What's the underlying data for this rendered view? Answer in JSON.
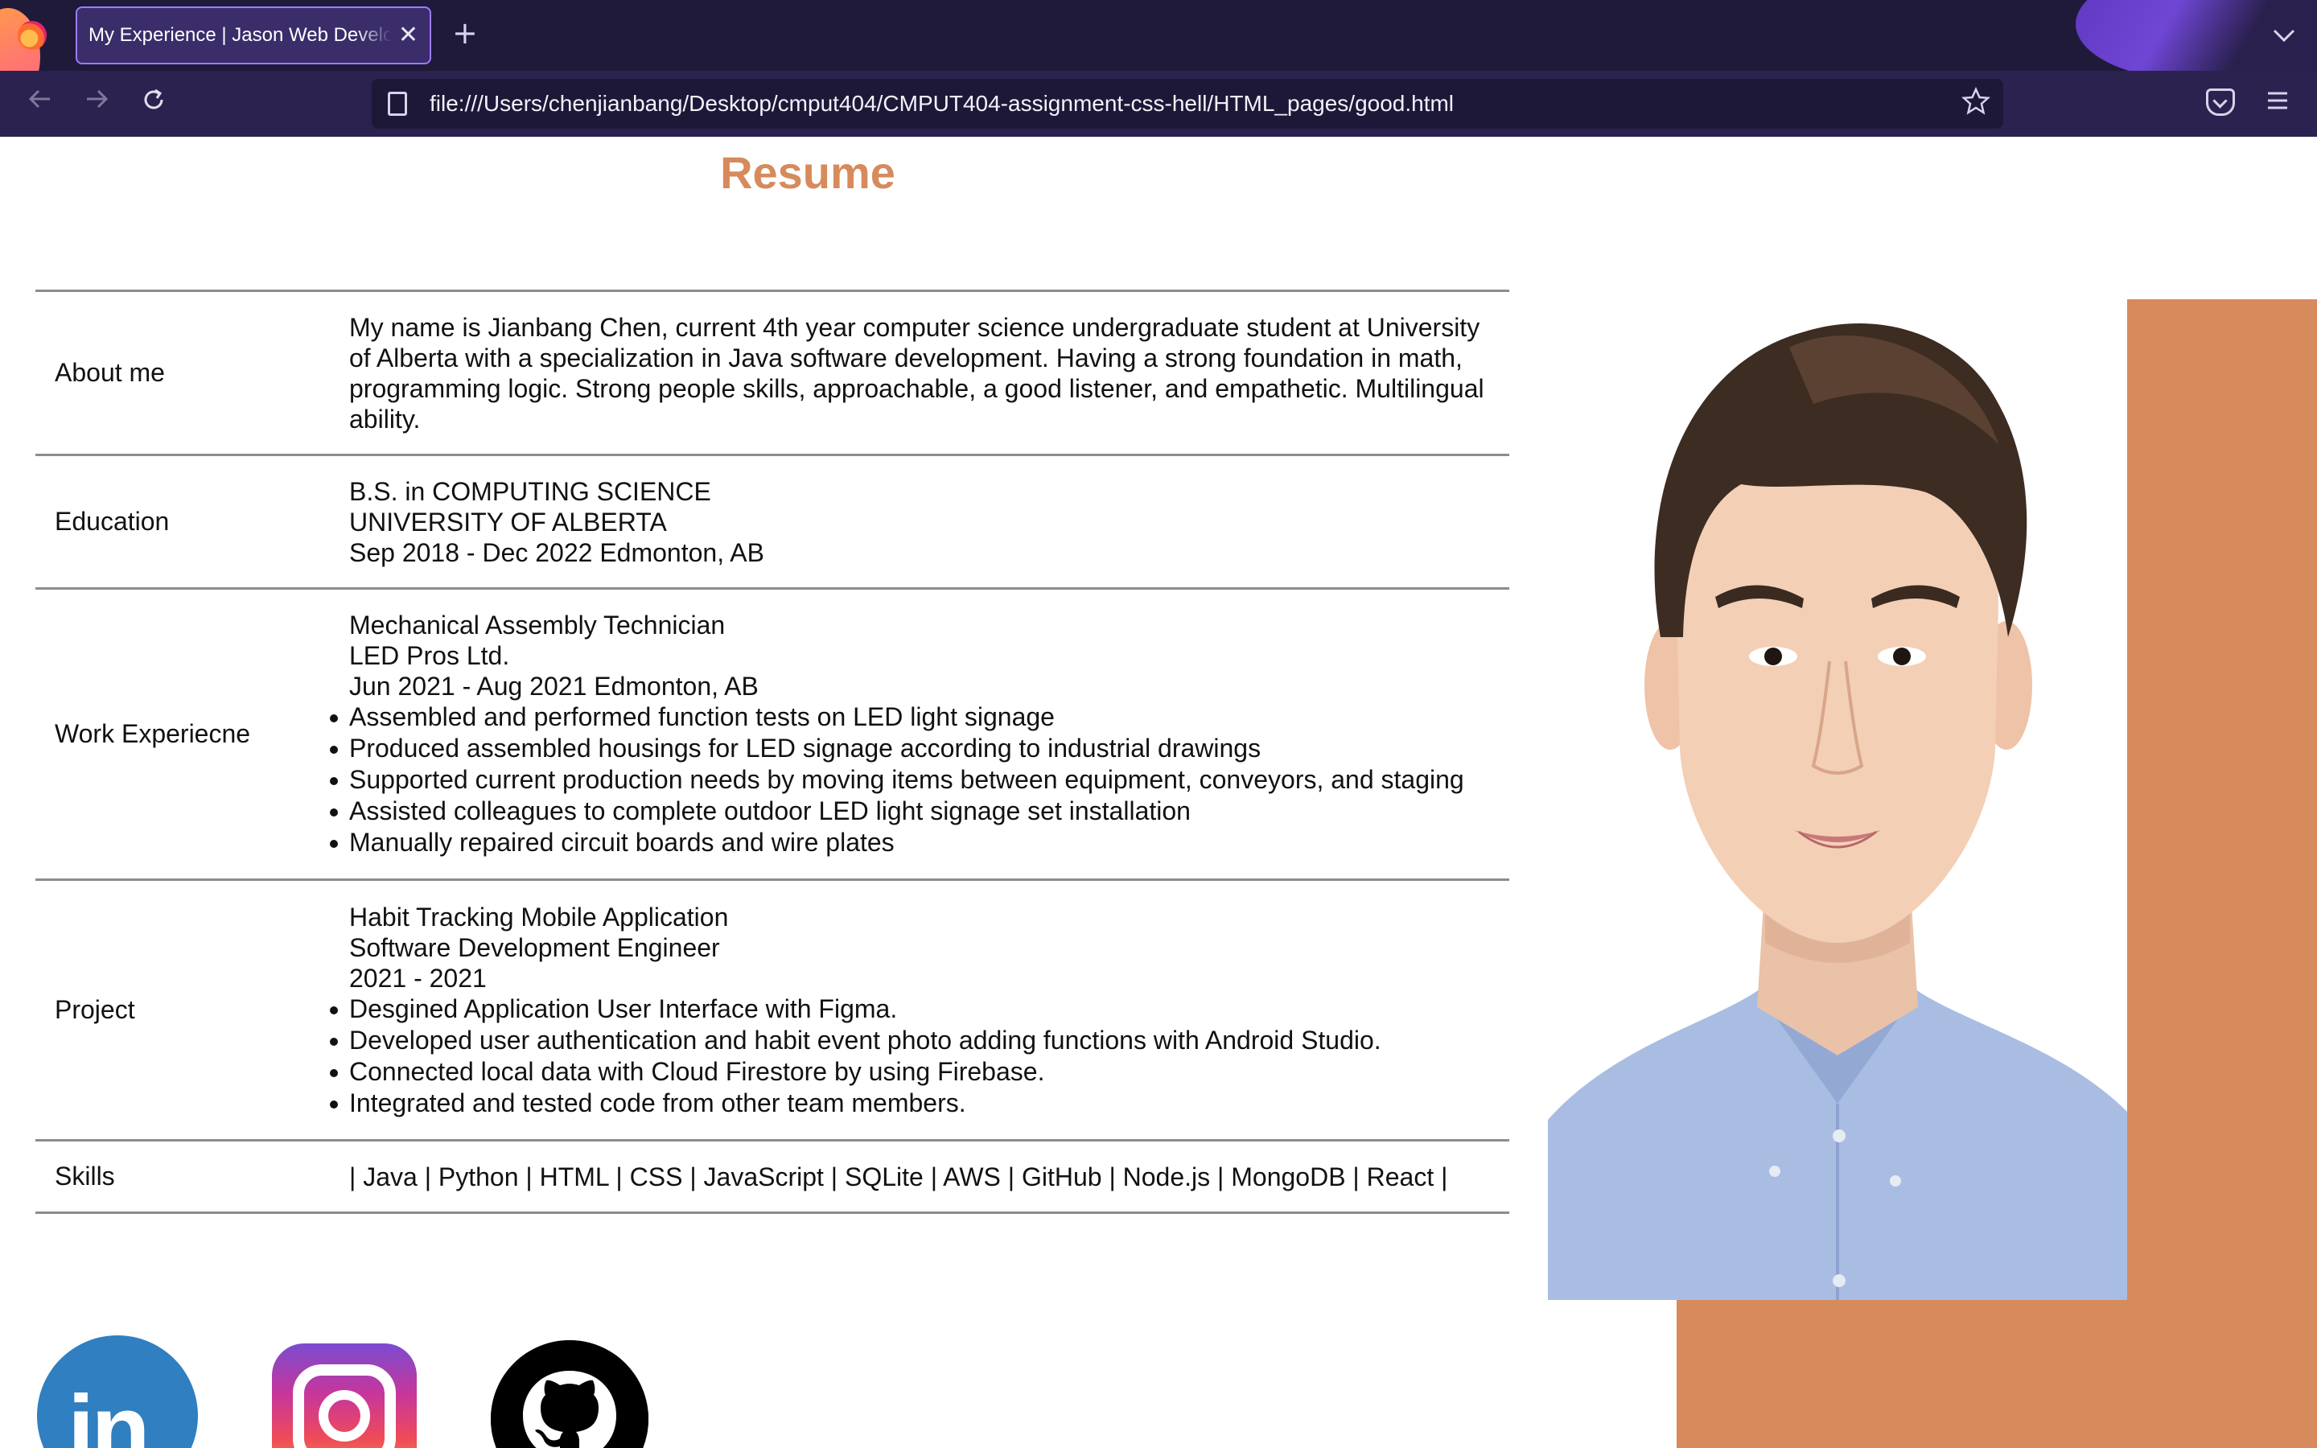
{
  "browser": {
    "tab_title": "My Experience | Jason Web Developer",
    "tab_close_glyph": "✕",
    "new_tab_glyph": "+",
    "url": "file:///Users/chenjianbang/Desktop/cmput404/CMPUT404-assignment-css-hell/HTML_pages/good.html",
    "icons": [
      "firefox-logo",
      "back-arrow-icon",
      "forward-arrow-icon",
      "reload-icon",
      "page-icon",
      "bookmark-star-icon",
      "pocket-icon",
      "menu-icon",
      "tabs-dropdown-icon"
    ]
  },
  "resume": {
    "title": "Resume",
    "rows": [
      {
        "label": "About me",
        "text": "My name is Jianbang Chen, current 4th year computer science undergraduate student at University of Alberta with a specialization in Java software development. Having a strong foundation in math, programming logic. Strong people skills, approachable, a good listener, and empathetic. Multilingual ability."
      },
      {
        "label": "Education",
        "lines": [
          "B.S. in COMPUTING SCIENCE",
          "UNIVERSITY OF ALBERTA",
          "Sep 2018 - Dec 2022 Edmonton, AB"
        ]
      },
      {
        "label": "Work Experiecne",
        "lines": [
          "Mechanical Assembly Technician",
          "LED Pros Ltd.",
          "Jun 2021 - Aug 2021 Edmonton, AB"
        ],
        "bullets": [
          "Assembled and performed function tests on LED light signage",
          "Produced assembled housings for LED signage according to industrial drawings",
          "Supported current production needs by moving items between equipment, conveyors, and staging",
          "Assisted colleagues to complete outdoor LED light signage set installation",
          "Manually repaired circuit boards and wire plates"
        ]
      },
      {
        "label": "Project",
        "lines": [
          "Habit Tracking Mobile Application",
          "Software Development Engineer",
          "2021 - 2021"
        ],
        "bullets": [
          "Desgined Application User Interface with Figma.",
          "Developed user authentication and habit event photo adding functions with Android Studio.",
          "Connected local data with Cloud Firestore by using Firebase.",
          "Integrated and tested code from other team members."
        ]
      },
      {
        "label": "Skills",
        "text": "| Java | Python | HTML | CSS | JavaScript | SQLite | AWS | GitHub | Node.js | MongoDB | React |"
      }
    ]
  },
  "colors": {
    "accent": "#d78a5c",
    "linkedin": "#2f7fc1",
    "tabbar": "#1f1a3a",
    "navbar": "#2b2250"
  },
  "social": {
    "linkedin_text": "in",
    "icons": [
      "linkedin-icon",
      "instagram-icon",
      "github-icon"
    ]
  }
}
